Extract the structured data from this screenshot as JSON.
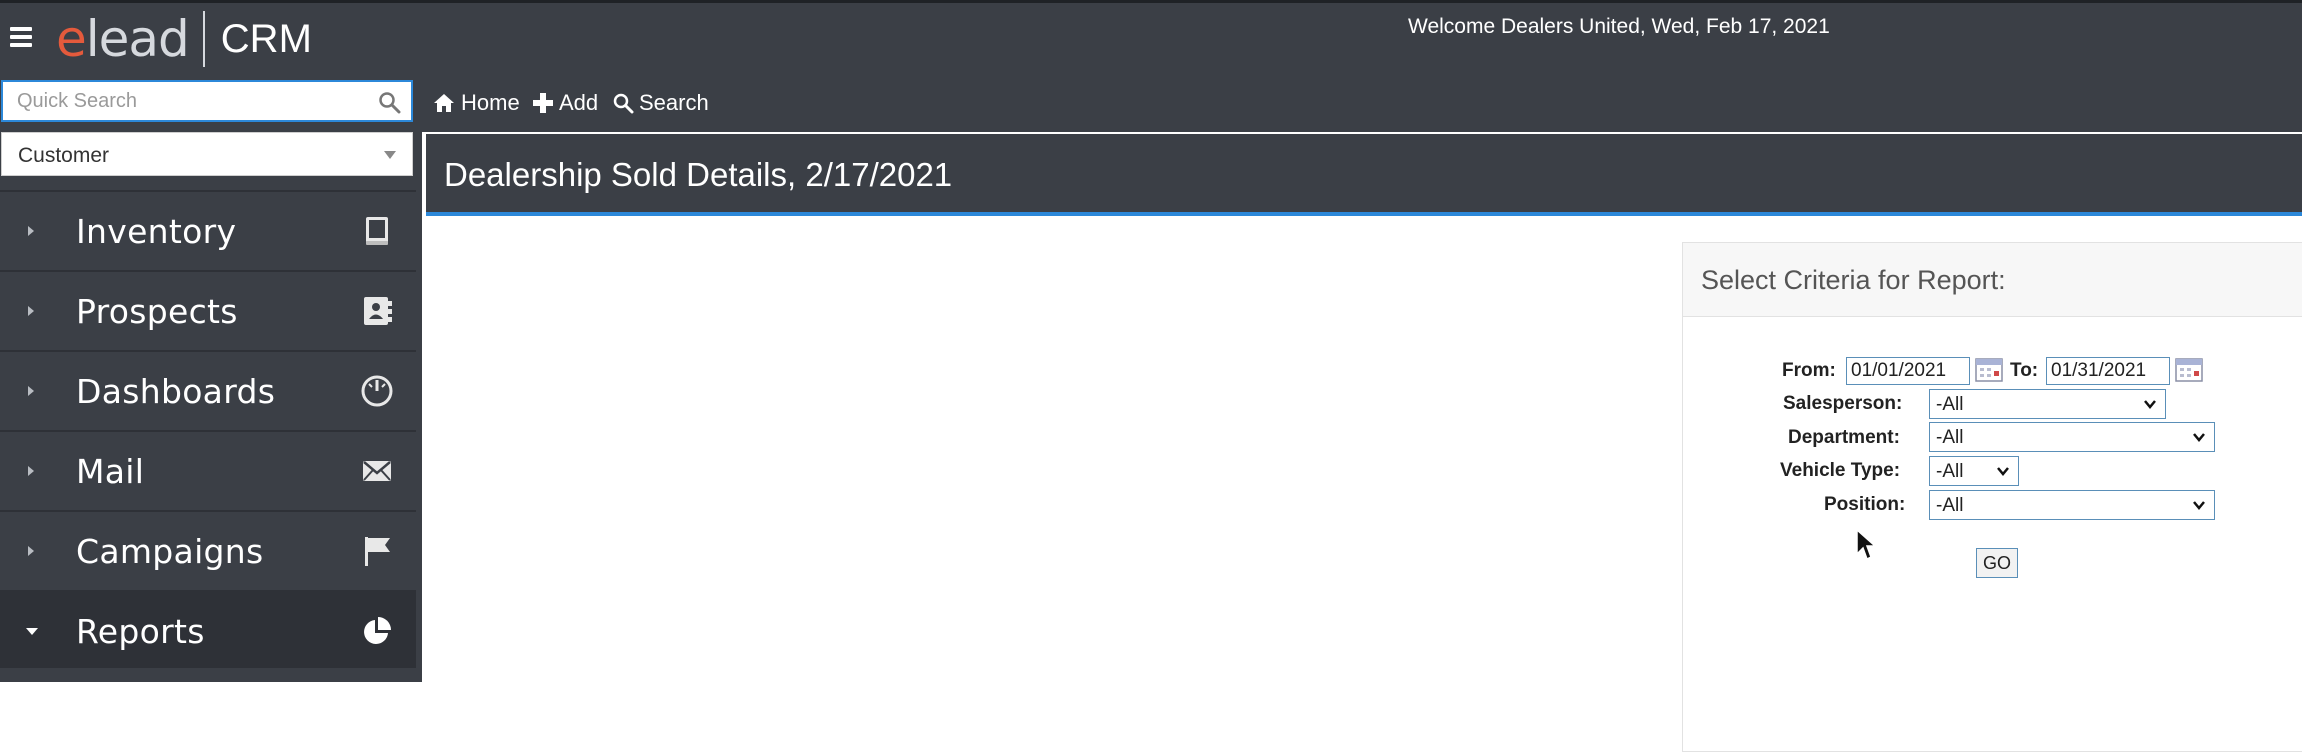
{
  "header": {
    "logo_e": "e",
    "logo_lead": "lead",
    "logo_crm": "CRM",
    "welcome": "Welcome Dealers United, Wed, Feb 17, 2021"
  },
  "sidebar": {
    "search_placeholder": "Quick Search",
    "search_type": "Customer",
    "items": [
      {
        "label": "Inventory",
        "icon": "book-icon",
        "expanded": false
      },
      {
        "label": "Prospects",
        "icon": "contacts-icon",
        "expanded": false
      },
      {
        "label": "Dashboards",
        "icon": "gauge-icon",
        "expanded": false
      },
      {
        "label": "Mail",
        "icon": "envelope-icon",
        "expanded": false
      },
      {
        "label": "Campaigns",
        "icon": "flag-icon",
        "expanded": false
      },
      {
        "label": "Reports",
        "icon": "pie-chart-icon",
        "expanded": true
      }
    ]
  },
  "toolbar": {
    "home": "Home",
    "add": "Add",
    "search": "Search"
  },
  "main": {
    "title": "Dealership Sold Details, 2/17/2021",
    "criteria": {
      "heading": "Select Criteria for Report:",
      "from_label": "From:",
      "from_value": "01/01/2021",
      "to_label": "To:",
      "to_value": "01/31/2021",
      "salesperson_label": "Salesperson:",
      "salesperson_value": "-All",
      "department_label": "Department:",
      "department_value": "-All",
      "vehicle_type_label": "Vehicle Type:",
      "vehicle_type_value": "-All",
      "position_label": "Position:",
      "position_value": "-All",
      "go_label": "GO"
    }
  },
  "colors": {
    "chrome": "#3b3f46",
    "accent": "#2c88d9",
    "logo_accent": "#e45a3c"
  }
}
